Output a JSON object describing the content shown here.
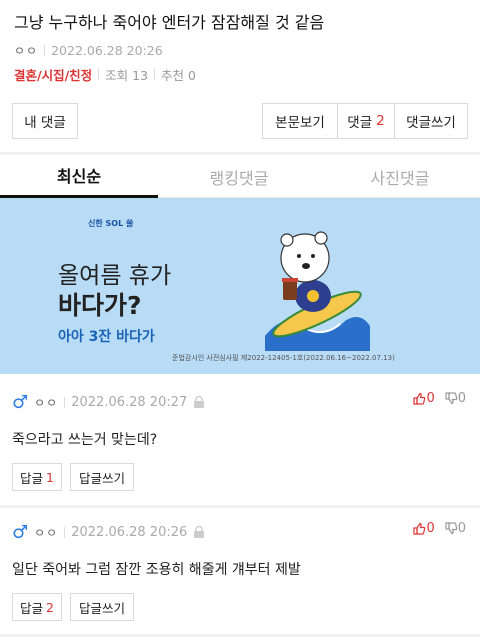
{
  "post": {
    "title": "그냥 누구하나 죽어야 엔터가 잠잠해질 것 같음",
    "author": "ㅇㅇ",
    "date": "2022.06.28 20:26",
    "category": "결혼/시집/친정",
    "views_label": "조회 13",
    "recommend_label": "추천 0"
  },
  "toolbar": {
    "my_comments": "내 댓글",
    "view_post": "본문보기",
    "comments_label": "댓글",
    "comments_count": "2",
    "write_comment": "댓글쓰기"
  },
  "tabs": [
    {
      "label": "최신순",
      "active": true
    },
    {
      "label": "랭킹댓글",
      "active": false
    },
    {
      "label": "사진댓글",
      "active": false
    }
  ],
  "banner": {
    "brand": "신한 SOL 쏠",
    "line1": "올여름 휴가",
    "line2": "바다가?",
    "line3": "아아 3잔 바다가",
    "legal": "준법감시인 사전심사필 제2022-12405-1호(2022.06.16~2022.07.13)"
  },
  "comments": [
    {
      "gender": "♂",
      "author": "ㅇㅇ",
      "date": "2022.06.28 20:27",
      "up": "0",
      "down": "0",
      "text": "죽으라고 쓰는거 맞는데?",
      "reply_label": "답글",
      "reply_count": "1",
      "write_reply": "답글쓰기"
    },
    {
      "gender": "♂",
      "author": "ㅇㅇ",
      "date": "2022.06.28 20:26",
      "up": "0",
      "down": "0",
      "text": "일단 죽어봐 그럼 잠깐 조용히 해줄게 걔부터 제발",
      "reply_label": "답글",
      "reply_count": "2",
      "write_reply": "답글쓰기"
    }
  ],
  "colors": {
    "accent_red": "#d33333",
    "male_blue": "#2c7be5",
    "banner_bg": "#b8dcf5"
  },
  "icons": {
    "lock": "lock-icon",
    "thumbs_up": "thumbs-up-icon",
    "thumbs_down": "thumbs-down-icon"
  }
}
